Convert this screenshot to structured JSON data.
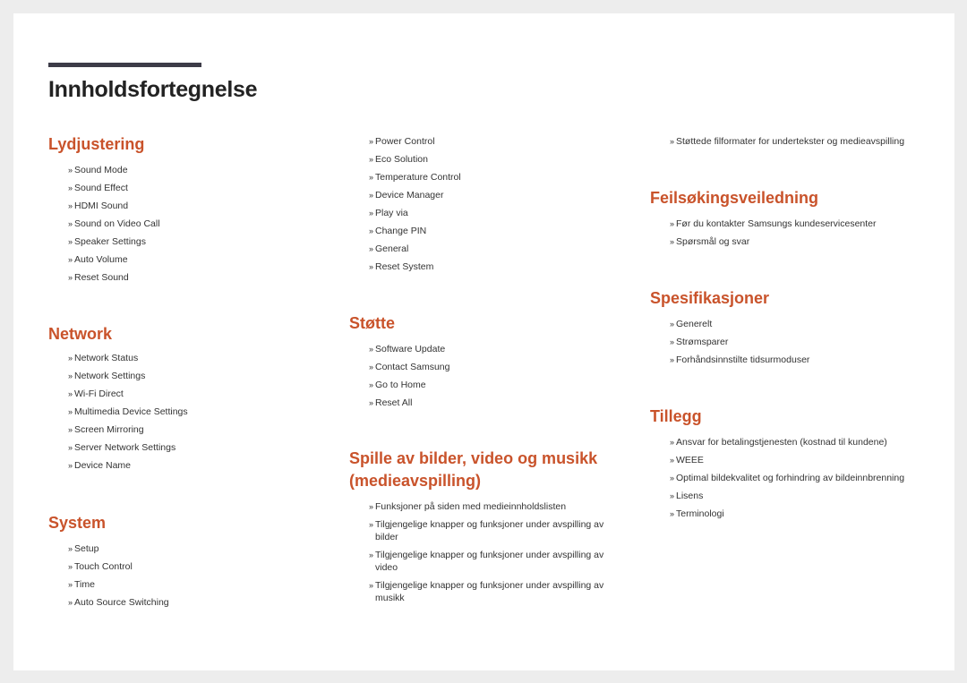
{
  "page": {
    "title": "Innholdsfortegnelse",
    "bullet": "»",
    "colors": {
      "accent": "#c9532b",
      "bar": "#3d3c48",
      "text": "#333333",
      "background": "#ededed"
    }
  },
  "sections": {
    "lydjustering": {
      "title": "Lydjustering",
      "items": [
        "Sound Mode",
        "Sound Effect",
        "HDMI Sound",
        "Sound on Video Call",
        "Speaker Settings",
        "Auto Volume",
        "Reset Sound"
      ]
    },
    "network": {
      "title": "Network",
      "items": [
        "Network Status",
        "Network Settings",
        "Wi-Fi Direct",
        "Multimedia Device Settings",
        "Screen Mirroring",
        "Server Network Settings",
        "Device Name"
      ]
    },
    "system": {
      "title": "System",
      "items": [
        "Setup",
        "Touch Control",
        "Time",
        "Auto Source Switching",
        "Power Control",
        "Eco Solution",
        "Temperature Control",
        "Device Manager",
        "Play via",
        "Change PIN",
        "General",
        "Reset System"
      ]
    },
    "stotte": {
      "title": "Støtte",
      "items": [
        "Software Update",
        "Contact Samsung",
        "Go to Home",
        "Reset All"
      ]
    },
    "media": {
      "title": "Spille av bilder, video og musikk (medieavspilling)",
      "items": [
        "Funksjoner på siden med medieinnholdslisten",
        "Tilgjengelige knapper og funksjoner under avspilling av bilder",
        "Tilgjengelige knapper og funksjoner under avspilling av video",
        "Tilgjengelige knapper og funksjoner under avspilling av musikk",
        "Støttede filformater for undertekster og medieavspilling"
      ]
    },
    "feilsoking": {
      "title": "Feilsøkingsveiledning",
      "items": [
        "Før du kontakter Samsungs kundeservicesenter",
        "Spørsmål og svar"
      ]
    },
    "spesifikasjoner": {
      "title": "Spesifikasjoner",
      "items": [
        "Generelt",
        "Strømsparer",
        "Forhåndsinnstilte tidsurmoduser"
      ]
    },
    "tillegg": {
      "title": "Tillegg",
      "items": [
        "Ansvar for betalingstjenesten (kostnad til kundene)",
        "WEEE",
        "Optimal bildekvalitet og forhindring av bildeinnbrenning",
        "Lisens",
        "Terminologi"
      ]
    }
  }
}
